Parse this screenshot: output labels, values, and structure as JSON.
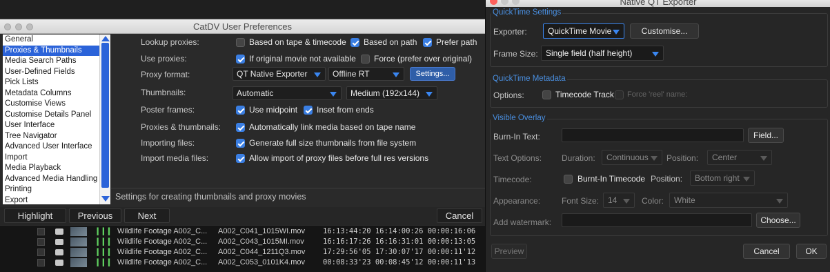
{
  "prefs": {
    "title": "CatDV User Preferences",
    "sidebar_items": [
      "General",
      "Proxies & Thumbnails",
      "Media Search Paths",
      "User-Defined Fields",
      "Pick Lists",
      "Metadata Columns",
      "Customise Views",
      "Customise Details Panel",
      "User Interface",
      "Tree Navigator",
      "Advanced User Interface",
      "Import",
      "Media Playback",
      "Advanced Media Handling",
      "Printing",
      "Export"
    ],
    "selected_item": "Proxies & Thumbnails",
    "form": {
      "lookup_label": "Lookup proxies:",
      "lookup_opt1": "Based on tape & timecode",
      "lookup_opt2": "Based on path",
      "lookup_opt3": "Prefer path",
      "use_label": "Use proxies:",
      "use_opt1": "If original movie not available",
      "use_opt2": "Force (prefer over original)",
      "format_label": "Proxy format:",
      "format_exporter": "QT Native Exporter",
      "format_preset": "Offline RT",
      "settings_button": "Settings...",
      "thumbs_label": "Thumbnails:",
      "thumbs_mode": "Automatic",
      "thumbs_size": "Medium (192x144)",
      "poster_label": "Poster frames:",
      "poster_opt1": "Use midpoint",
      "poster_opt2": "Inset from ends",
      "pt_label": "Proxies & thumbnails:",
      "pt_opt": "Automatically link media based on tape name",
      "import_label": "Importing files:",
      "import_opt": "Generate full size thumbnails from file system",
      "importmedia_label": "Import media files:",
      "importmedia_opt": "Allow import of proxy files before full res versions"
    },
    "hint": "Settings for creating thumbnails and proxy movies",
    "buttons": {
      "highlight": "Highlight",
      "previous": "Previous",
      "next": "Next",
      "cancel": "Cancel"
    }
  },
  "media_rows": [
    {
      "name": "Wildlife Footage A002_C...",
      "file": "A002_C041_1015WI.mov",
      "timecode": "16:13:44:20 16:14:00:26 00:00:16:06"
    },
    {
      "name": "Wildlife Footage A002_C...",
      "file": "A002_C043_1015MI.mov",
      "timecode": "16:16:17:26 16:16:31:01 00:00:13:05"
    },
    {
      "name": "Wildlife Footage A002_C...",
      "file": "A002_C044_1211Q3.mov",
      "timecode": "17:29:56'05 17:30:07'17 00:00:11'12"
    },
    {
      "name": "Wildlife Footage A002_C...",
      "file": "A002_C053_0101K4.mov",
      "timecode": "00:08:33'23 00:08:45'12 00:00:11'13"
    }
  ],
  "qt": {
    "title": "Native QT Exporter",
    "settings_head": "QuickTime Settings",
    "exporter_label": "Exporter:",
    "exporter_value": "QuickTime Movie",
    "customise_button": "Customise...",
    "framesize_label": "Frame Size:",
    "framesize_value": "Single field (half height)",
    "metadata_head": "QuickTime Metadata",
    "options_label": "Options:",
    "timecode_track": "Timecode Track",
    "force_reel": "Force 'reel' name:",
    "overlay_head": "Visible Overlay",
    "burnin_label": "Burn-In Text:",
    "field_button": "Field...",
    "textopts_label": "Text Options:",
    "duration_label": "Duration:",
    "duration_value": "Continuous",
    "position_label": "Position:",
    "position_value": "Center",
    "timecode_label": "Timecode:",
    "burnin_timecode": "Burnt-In Timecode",
    "tc_position_label": "Position:",
    "tc_position_value": "Bottom right",
    "appearance_label": "Appearance:",
    "fontsize_label": "Font Size:",
    "fontsize_value": "14",
    "color_label": "Color:",
    "color_value": "White",
    "watermark_label": "Add watermark:",
    "choose_button": "Choose...",
    "preview_button": "Preview",
    "cancel_button": "Cancel",
    "ok_button": "OK"
  },
  "colors": {
    "accent": "#3a7ee2",
    "selection": "#2b63d9",
    "section_head": "#4a90e2"
  }
}
